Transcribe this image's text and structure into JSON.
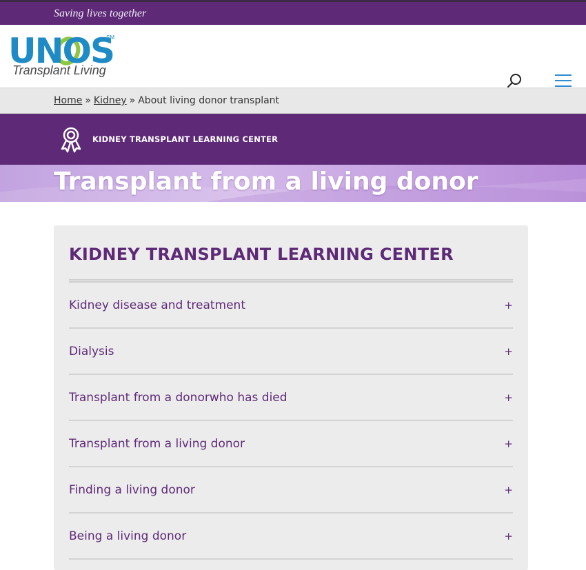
{
  "topbar": {
    "tagline": "Saving lives together"
  },
  "header": {
    "logo_text": "UNOS",
    "logo_mark": "SM",
    "logo_subtitle": "Transplant Living",
    "search_icon": "search-icon",
    "menu_icon": "hamburger-menu-icon"
  },
  "breadcrumb": {
    "items": [
      "Home",
      "Kidney",
      "About living donor transplant"
    ],
    "separator": "»"
  },
  "learning_center": {
    "icon": "award-ribbon-icon",
    "label": "KIDNEY TRANSPLANT LEARNING CENTER"
  },
  "hero": {
    "title": "Transplant from a living donor"
  },
  "panel": {
    "title": "KIDNEY TRANSPLANT LEARNING CENTER",
    "items": [
      {
        "label": "Kidney disease and treatment",
        "toggle": "+"
      },
      {
        "label": "Dialysis",
        "toggle": "+"
      },
      {
        "label": "Transplant from a donorwho has died",
        "toggle": "+"
      },
      {
        "label": "Transplant from a living donor",
        "toggle": "+"
      },
      {
        "label": "Finding a living donor",
        "toggle": "+"
      },
      {
        "label": "Being a living donor",
        "toggle": "+"
      }
    ]
  },
  "colors": {
    "brand_purple": "#5e2a78",
    "logo_blue": "#1f8bc6",
    "logo_green": "#8dc63f",
    "hero_lavender": "#c9aae4",
    "menu_blue": "#2e8bd0"
  }
}
